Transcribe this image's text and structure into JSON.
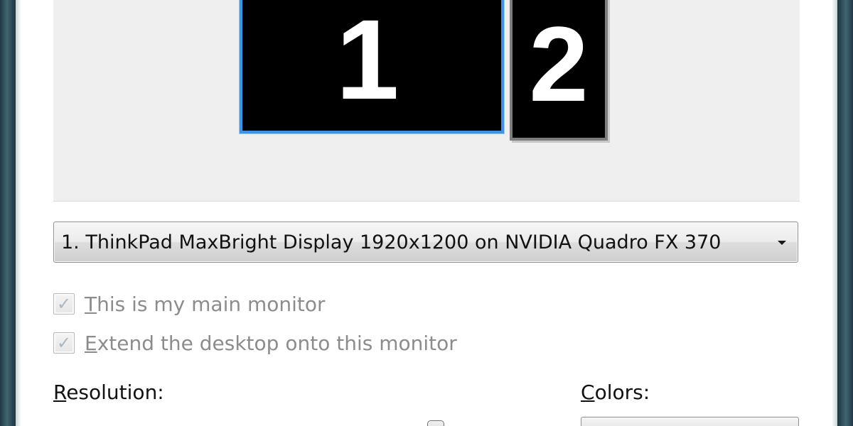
{
  "preview": {
    "monitors": [
      {
        "number": "1",
        "selected": true
      },
      {
        "number": "2",
        "selected": false
      }
    ]
  },
  "display_select": {
    "value": "1. ThinkPad MaxBright Display 1920x1200 on NVIDIA Quadro FX 370"
  },
  "checkboxes": {
    "main_monitor": {
      "first_letter": "T",
      "rest": "his is my main monitor",
      "checked": true,
      "enabled": false
    },
    "extend_desktop": {
      "first_letter": "E",
      "rest": "xtend the desktop onto this monitor",
      "checked": true,
      "enabled": false
    }
  },
  "resolution": {
    "first_letter": "R",
    "rest": "esolution:"
  },
  "colors": {
    "first_letter": "C",
    "rest": "olors:"
  },
  "icons": {
    "dropdown": "chevron-down-icon",
    "check": "checkmark-icon"
  },
  "colors_theme": {
    "selected_monitor_border": "#3d93e6",
    "monitor_fill": "#000000",
    "preview_background": "#efefef",
    "disabled_text": "#8c8c8c"
  }
}
